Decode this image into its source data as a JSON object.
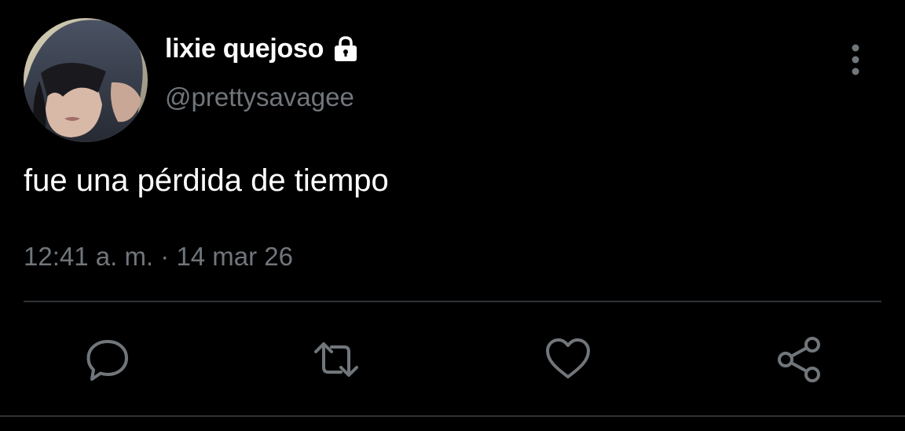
{
  "tweet": {
    "author": {
      "display_name": "lixie quejoso",
      "handle": "@prettysavagee",
      "protected_icon": "lock-icon",
      "avatar": "avatar"
    },
    "text": "fue una pérdida de tiempo",
    "time": "12:41 a. m.",
    "separator": " · ",
    "date": "14 mar 26"
  },
  "header": {
    "more_icon": "more-vertical-icon"
  },
  "actions": [
    {
      "name": "reply",
      "icon": "reply-icon"
    },
    {
      "name": "retweet",
      "icon": "retweet-icon"
    },
    {
      "name": "like",
      "icon": "heart-icon"
    },
    {
      "name": "share",
      "icon": "share-icon"
    }
  ],
  "colors": {
    "background": "#000000",
    "primary_text": "#ffffff",
    "secondary_text": "#71767b",
    "divider": "#2f3336"
  }
}
